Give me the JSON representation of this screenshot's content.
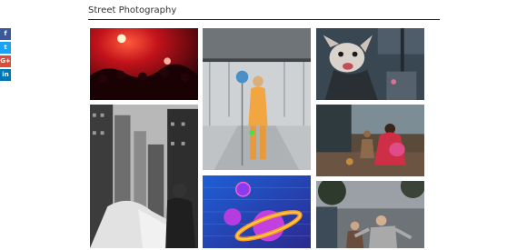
{
  "section": {
    "title": "Street Photography"
  },
  "share": [
    {
      "icon": "facebook-icon",
      "glyph": "f",
      "color": "#3b5998"
    },
    {
      "icon": "twitter-icon",
      "glyph": "t",
      "color": "#1da1f2"
    },
    {
      "icon": "google-plus-icon",
      "glyph": "G+",
      "color": "#dd4b39"
    },
    {
      "icon": "linkedin-icon",
      "glyph": "in",
      "color": "#0077b5"
    }
  ],
  "colors": {
    "rule": "#222222",
    "title": "#333333"
  }
}
